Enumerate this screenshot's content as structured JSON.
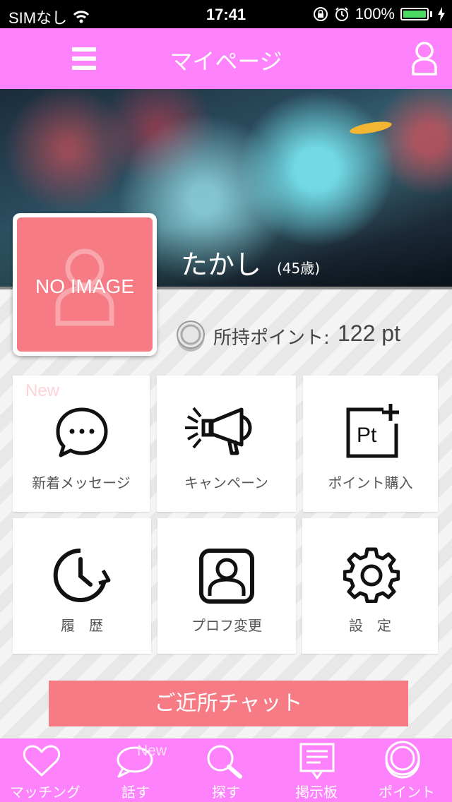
{
  "status_bar": {
    "carrier": "SIMなし",
    "time": "17:41",
    "battery_percent": "100%"
  },
  "header": {
    "title": "マイページ"
  },
  "profile": {
    "avatar_placeholder": "NO IMAGE",
    "name": "たかし",
    "age": "(45歳)",
    "points_label": "所持ポイント:",
    "points_value": "122 pt"
  },
  "menu": {
    "new_badge": "New",
    "items": [
      {
        "label": "新着メッセージ",
        "icon": "chat-bubble-icon"
      },
      {
        "label": "キャンペーン",
        "icon": "megaphone-icon"
      },
      {
        "label": "ポイント購入",
        "icon": "points-purchase-icon"
      },
      {
        "label": "履　歴",
        "icon": "history-clock-icon"
      },
      {
        "label": "プロフ変更",
        "icon": "profile-card-icon"
      },
      {
        "label": "設　定",
        "icon": "gear-icon"
      }
    ]
  },
  "chat_button": {
    "label": "ご近所チャット"
  },
  "tabbar": {
    "new_badge": "New",
    "items": [
      {
        "label": "マッチング",
        "icon": "heart-icon"
      },
      {
        "label": "話す",
        "icon": "speech-bubble-icon"
      },
      {
        "label": "探す",
        "icon": "magnifier-icon"
      },
      {
        "label": "掲示板",
        "icon": "bulletin-board-icon"
      },
      {
        "label": "ポイント",
        "icon": "coin-icon"
      }
    ]
  },
  "colors": {
    "header": "#fd82fb",
    "accent": "#f77b85",
    "battery": "#4cd964"
  }
}
